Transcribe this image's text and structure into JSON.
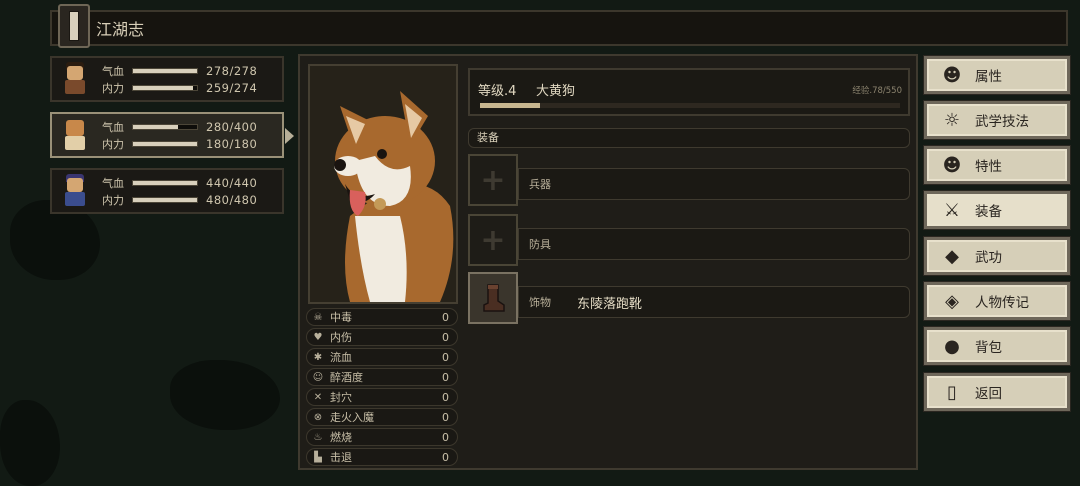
{
  "header": {
    "title": "江湖志"
  },
  "party": [
    {
      "hp_label": "气血",
      "hp_value": "278/278",
      "hp_pct": 1.0,
      "mp_label": "内力",
      "mp_value": "259/274",
      "mp_pct": 0.945,
      "selected": false
    },
    {
      "hp_label": "气血",
      "hp_value": "280/400",
      "hp_pct": 0.7,
      "mp_label": "内力",
      "mp_value": "180/180",
      "mp_pct": 1.0,
      "selected": true
    },
    {
      "hp_label": "气血",
      "hp_value": "440/440",
      "hp_pct": 1.0,
      "mp_label": "内力",
      "mp_value": "480/480",
      "mp_pct": 1.0,
      "selected": false
    }
  ],
  "character": {
    "level_label": "等级.4",
    "name": "大黄狗",
    "exp_text": "经验.78/550",
    "exp_pct": 0.142
  },
  "status_effects": [
    {
      "icon": "skull-icon",
      "glyph": "☠",
      "label": "中毒",
      "value": "0"
    },
    {
      "icon": "broken-heart-icon",
      "glyph": "♥",
      "label": "内伤",
      "value": "0"
    },
    {
      "icon": "blood-drop-icon",
      "glyph": "✱",
      "label": "流血",
      "value": "0"
    },
    {
      "icon": "drunk-face-icon",
      "glyph": "☺",
      "label": "醉酒度",
      "value": "0"
    },
    {
      "icon": "acupoint-icon",
      "glyph": "✕",
      "label": "封穴",
      "value": "0"
    },
    {
      "icon": "qi-deviation-icon",
      "glyph": "⊗",
      "label": "走火入魔",
      "value": "0"
    },
    {
      "icon": "flame-icon",
      "glyph": "♨",
      "label": "燃烧",
      "value": "0"
    },
    {
      "icon": "knockback-icon",
      "glyph": "▙",
      "label": "击退",
      "value": "0"
    }
  ],
  "equipment": {
    "header": "装备",
    "slots": [
      {
        "type": "兵器",
        "item": "",
        "filled": false
      },
      {
        "type": "防具",
        "item": "",
        "filled": false
      },
      {
        "type": "饰物",
        "item": "东陵落跑靴",
        "filled": true
      }
    ]
  },
  "menu": [
    {
      "label": "属性",
      "icon": "person-icon",
      "glyph": "☻",
      "active": false
    },
    {
      "label": "武学技法",
      "icon": "martial-skill-icon",
      "glyph": "☼",
      "active": false
    },
    {
      "label": "特性",
      "icon": "trait-icon",
      "glyph": "☻",
      "active": false
    },
    {
      "label": "装备",
      "icon": "sword-icon",
      "glyph": "⚔",
      "active": true
    },
    {
      "label": "武功",
      "icon": "manual-book-icon",
      "glyph": "◆",
      "active": false
    },
    {
      "label": "人物传记",
      "icon": "biography-book-icon",
      "glyph": "◈",
      "active": false
    },
    {
      "label": "背包",
      "icon": "bag-icon",
      "glyph": "●",
      "active": false
    },
    {
      "label": "返回",
      "icon": "exit-door-icon",
      "glyph": "▯",
      "active": false
    }
  ],
  "colors": {
    "accent_fill": "#d8d0bc",
    "exp_fill": "#c7b68f",
    "button_bg": "#d6cfb8"
  }
}
